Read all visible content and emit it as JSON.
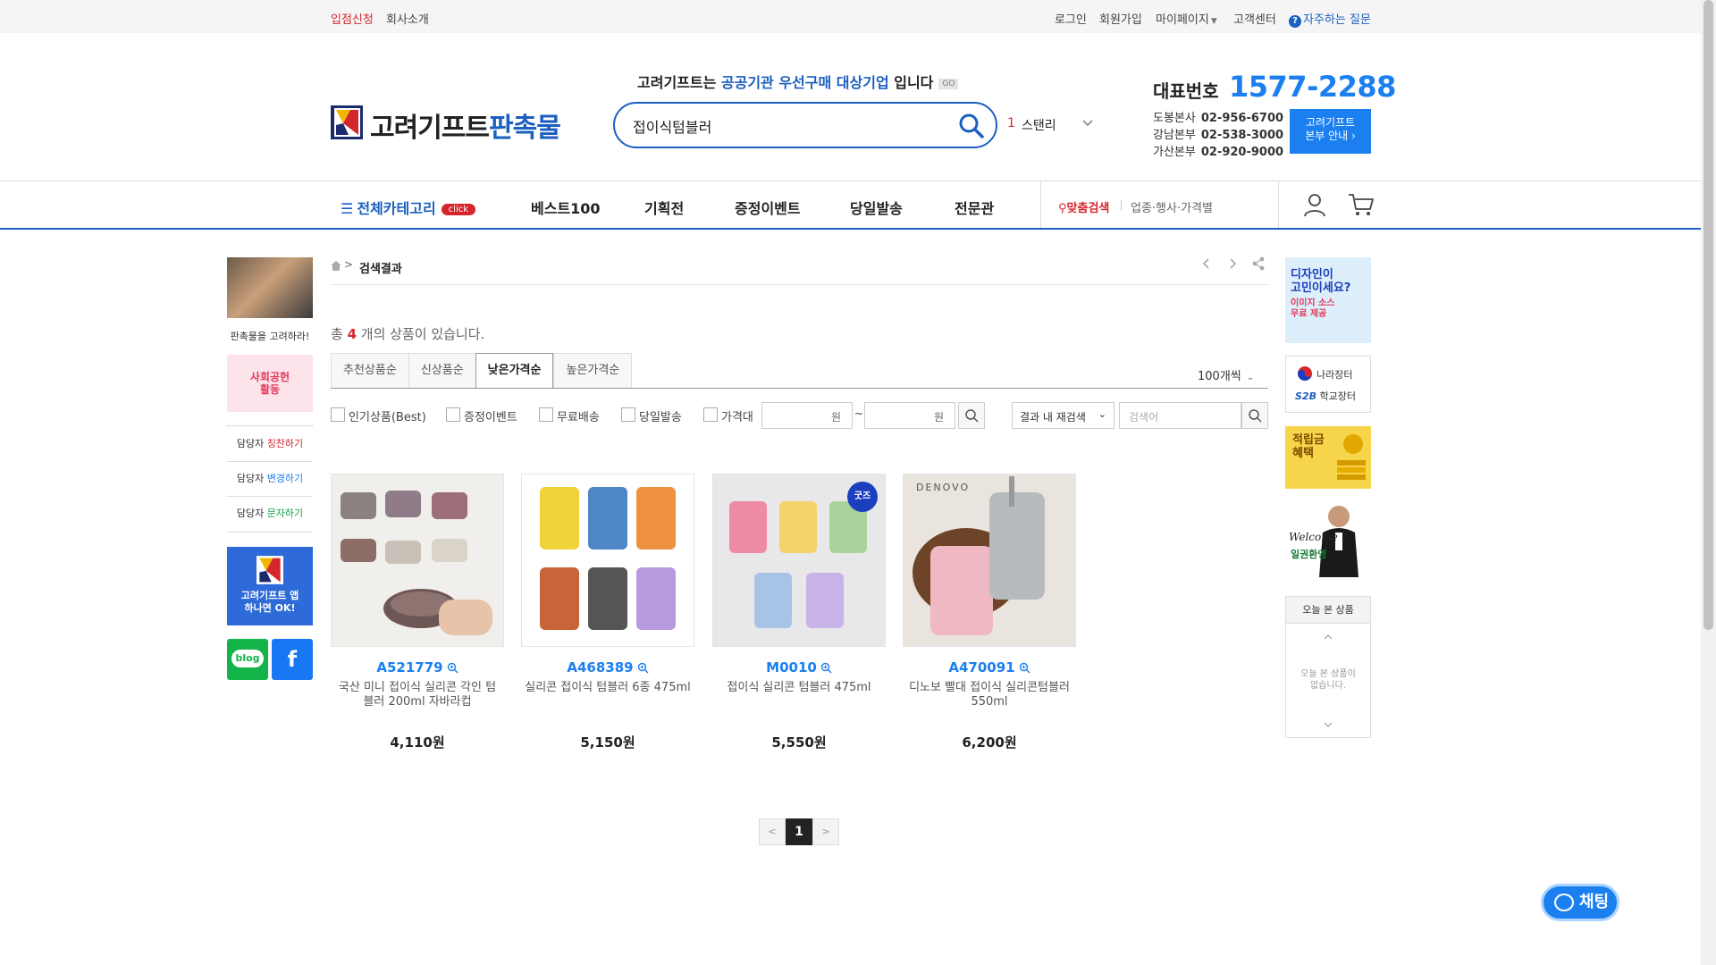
{
  "topbar": {
    "store_apply": "입점신청",
    "about": "회사소개",
    "login": "로그인",
    "signup": "회원가입",
    "mypage": "마이페이지",
    "customer": "고객센터",
    "faq": "자주하는 질문"
  },
  "header": {
    "logo_main": "고려기프트",
    "logo_accent": "판촉물",
    "notice_prefix": "고려기프트는 ",
    "notice_highlight": "공공기관 우선구매 대상기업",
    "notice_suffix": " 입니다",
    "notice_go": "GO",
    "search_value": "접이식텀블러",
    "rank_number": "1",
    "rank_keyword": "스탠리",
    "rep_label": "대표번호",
    "rep_number": "1577-2288",
    "branches": [
      {
        "name": "도봉본사",
        "phone": "02-956-6700"
      },
      {
        "name": "강남본부",
        "phone": "02-538-3000"
      },
      {
        "name": "가산본부",
        "phone": "02-920-9000"
      }
    ],
    "branch_btn_l1": "고려기프트",
    "branch_btn_l2": "본부 안내 ›"
  },
  "nav": {
    "all_categories": "전체카테고리",
    "click_badge": "click",
    "items": [
      "베스트100",
      "기획전",
      "증정이벤트",
      "당일발송",
      "전문관"
    ],
    "custom_search": "맞춤검색",
    "custom_search_sub": "업종·행사·가격별"
  },
  "left_sidebar": {
    "promo_caption": "판촉물을 고려하라!",
    "social_l1": "사회공헌",
    "social_l2": "활동",
    "manager": [
      {
        "prefix": "담당자 ",
        "action": "칭찬하기",
        "color": "#d6262d"
      },
      {
        "prefix": "담당자 ",
        "action": "변경하기",
        "color": "#1b7ff0"
      },
      {
        "prefix": "담당자 ",
        "action": "문자하기",
        "color": "#15a34a"
      }
    ],
    "app_l1": "고려기프트 앱",
    "app_l2": "하나면 OK!",
    "blog": "blog",
    "facebook": "f"
  },
  "breadcrumb": {
    "current": "검색결과"
  },
  "results": {
    "prefix": "총 ",
    "count": "4",
    "suffix": " 개의 상품이 있습니다."
  },
  "sort_tabs": [
    "추천상품순",
    "신상품순",
    "낮은가격순",
    "높은가격순"
  ],
  "active_sort": "낮은가격순",
  "per_page": "100개씩",
  "filters": {
    "checkboxes": [
      "인기상품(Best)",
      "증정이벤트",
      "무료배송",
      "당일발송",
      "가격대"
    ],
    "price_unit": "원",
    "tilde": "~",
    "refine_select": "결과 내 재검색",
    "refine_placeholder": "검색어"
  },
  "products": [
    {
      "code": "A521779",
      "name": "국산 미니 접이식 실리콘 각인 텀블러 200ml 자바라컵",
      "price": "4,110원",
      "badge": "",
      "brand": ""
    },
    {
      "code": "A468389",
      "name": "실리콘 접이식 텀블러 6종 475ml",
      "price": "5,150원",
      "badge": "",
      "brand": ""
    },
    {
      "code": "M0010",
      "name": "접이식 실리콘 텀블러 475ml",
      "price": "5,550원",
      "badge": "굿즈",
      "brand": ""
    },
    {
      "code": "A470091",
      "name": "디노보 빨대 접이식 실리콘텀블러 550ml",
      "price": "6,200원",
      "badge": "",
      "brand": "DENOVO"
    }
  ],
  "pagination": {
    "prev": "<",
    "current": "1",
    "next": ">"
  },
  "right_sidebar": {
    "design_l1": "디자인이",
    "design_l2": "고민이세요?",
    "design_sub1": "이미지 소스",
    "design_sub2": "무료 제공",
    "nara": "나라장터",
    "s2b": "S2B",
    "school": "학교장터",
    "point_l1": "적립금",
    "point_l2": "혜택",
    "welcome": "Welcome",
    "welcome_sub": "일권환영",
    "recent_title": "오늘 본 상품",
    "recent_empty_l1": "오늘 본 상품이",
    "recent_empty_l2": "없습니다."
  },
  "chat": "채팅",
  "colors": {
    "brand_blue": "#1b5fbf",
    "accent_blue": "#1b7ff0",
    "accent_red": "#d6262d"
  }
}
